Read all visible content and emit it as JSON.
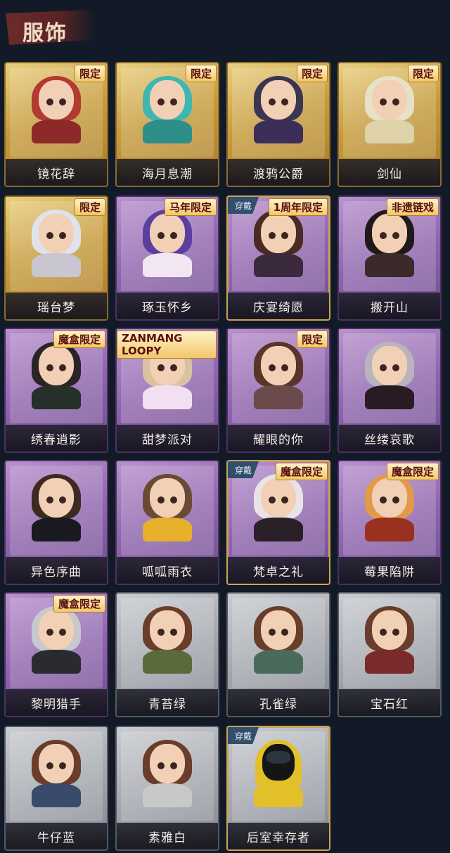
{
  "header": {
    "title": "服饰"
  },
  "costumes": [
    {
      "name": "镜花辞",
      "frame": "gold",
      "tag": "限定",
      "equipped": false
    },
    {
      "name": "海月息潮",
      "frame": "gold",
      "tag": "限定",
      "equipped": false
    },
    {
      "name": "渡鸦公爵",
      "frame": "gold",
      "tag": "限定",
      "equipped": false
    },
    {
      "name": "剑仙",
      "frame": "gold",
      "tag": "限定",
      "equipped": false
    },
    {
      "name": "瑶台梦",
      "frame": "gold",
      "tag": "限定",
      "equipped": false
    },
    {
      "name": "琢玉怀乡",
      "frame": "purple",
      "tag": "马年限定",
      "equipped": false
    },
    {
      "name": "庆宴绮愿",
      "frame": "purple",
      "tag": "1周年限定",
      "equipped": true,
      "equipped_label": "穿戴"
    },
    {
      "name": "搬开山",
      "frame": "purple",
      "tag": "非遗链戏",
      "equipped": false
    },
    {
      "name": "绣春逍影",
      "frame": "purple",
      "tag": "魔盒限定",
      "equipped": false
    },
    {
      "name": "甜梦派对",
      "frame": "purple",
      "tag": "ZANMANG LOOPY",
      "equipped": false
    },
    {
      "name": "耀眼的你",
      "frame": "purple",
      "tag": "限定",
      "equipped": false
    },
    {
      "name": "丝缕哀歌",
      "frame": "purple",
      "tag": "",
      "equipped": false
    },
    {
      "name": "异色序曲",
      "frame": "purple",
      "tag": "",
      "equipped": false
    },
    {
      "name": "呱呱雨衣",
      "frame": "purple",
      "tag": "",
      "equipped": false
    },
    {
      "name": "梵卓之礼",
      "frame": "purple",
      "tag": "魔盒限定",
      "equipped": true,
      "equipped_label": "穿戴"
    },
    {
      "name": "莓果陷阱",
      "frame": "purple",
      "tag": "魔盒限定",
      "equipped": false
    },
    {
      "name": "黎明猎手",
      "frame": "purple",
      "tag": "魔盒限定",
      "equipped": false
    },
    {
      "name": "青苔绿",
      "frame": "gray",
      "tag": "",
      "equipped": false
    },
    {
      "name": "孔雀绿",
      "frame": "gray",
      "tag": "",
      "equipped": false
    },
    {
      "name": "宝石红",
      "frame": "gray",
      "tag": "",
      "equipped": false
    },
    {
      "name": "牛仔蓝",
      "frame": "gray",
      "tag": "",
      "equipped": false
    },
    {
      "name": "素雅白",
      "frame": "gray",
      "tag": "",
      "equipped": false
    },
    {
      "name": "后室幸存者",
      "frame": "gray",
      "tag": "",
      "equipped": true,
      "equipped_label": "穿戴"
    }
  ],
  "colors": {
    "background": "#121a28",
    "gold_frame": "#c79b3c",
    "purple_frame": "#8e64ad",
    "gray_frame": "#9fa3aa",
    "tag_text": "#5a1010"
  }
}
